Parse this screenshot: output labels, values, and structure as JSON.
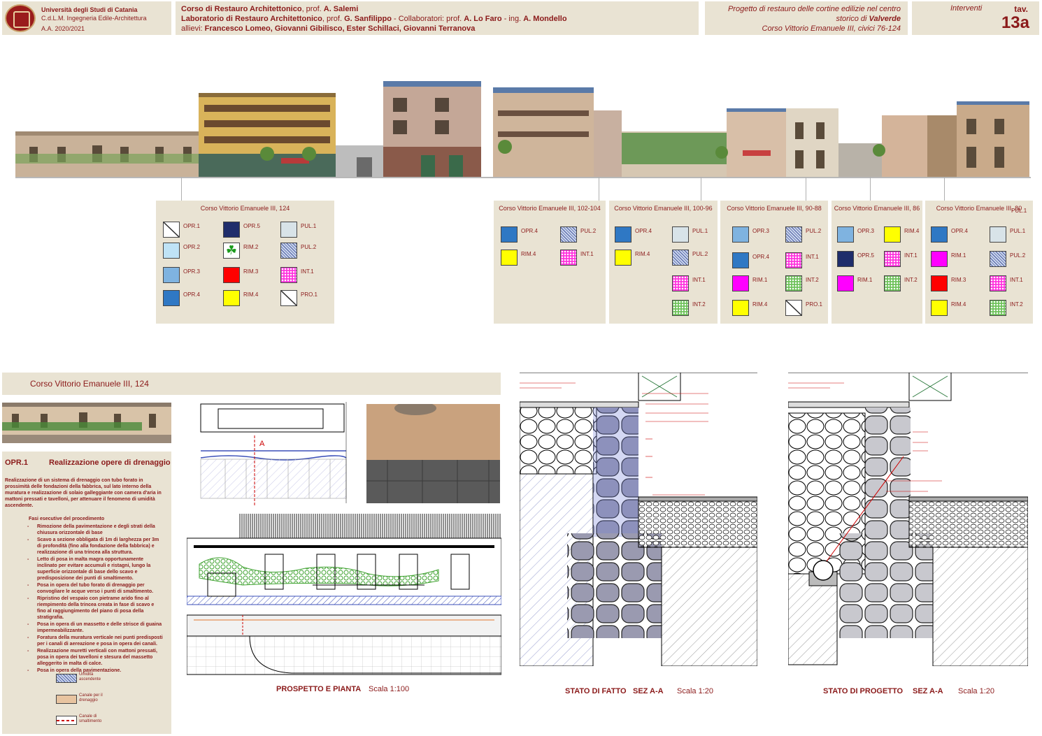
{
  "header": {
    "university": "Università degli Studi di Catania",
    "course": "C.d.L.M. Ingegneria Edile-Architettura",
    "year": "A.A. 2020/2021",
    "line1_a": "Corso di Restauro Architettonico",
    "line1_b": ", prof. ",
    "line1_c": "A. Salemi",
    "line2_a": "Laboratorio di Restauro Architettonico",
    "line2_b": ", prof. ",
    "line2_c": "G. Sanfilippo",
    "line2_d": " - Collaboratori: prof. ",
    "line2_e": "A. Lo Faro",
    "line2_f": " - ing. ",
    "line2_g": "A. Mondello",
    "line3_a": "allievi:  ",
    "line3_b": "Francesco Lomeo, Giovanni Gibilisco, Ester Schillaci, Giovanni Terranova",
    "project_1": "Progetto di restauro delle cortine edilizie nel centro",
    "project_2a": "storico di ",
    "project_2b": "Valverde",
    "project_3": "Corso Vittorio Emanuele III, civici 76-124",
    "section": "Interventi",
    "tav_label": "tav.",
    "tav_num": "13a"
  },
  "legends": [
    {
      "title": "Corso Vittorio Emanuele III, 124",
      "items": [
        {
          "code": "OPR.1",
          "swatch": "diag-white"
        },
        {
          "code": "OPR.2",
          "swatch": "#bfe3f6"
        },
        {
          "code": "OPR.3",
          "swatch": "#7fb3e0"
        },
        {
          "code": "OPR.4",
          "swatch": "#2f78c4"
        },
        {
          "code": "OPR.5",
          "swatch": "#1f2d6b"
        },
        {
          "code": "RIM.2",
          "swatch": "clover"
        },
        {
          "code": "RIM.3",
          "swatch": "#ff0000"
        },
        {
          "code": "RIM.4",
          "swatch": "#ffff00"
        },
        {
          "code": "PUL.1",
          "swatch": "#d8e3e8"
        },
        {
          "code": "PUL.2",
          "swatch": "hatch-blue"
        },
        {
          "code": "INT.1",
          "swatch": "dots-magenta"
        },
        {
          "code": "PRO.1",
          "swatch": "diag-white"
        }
      ]
    },
    {
      "title": "Corso Vittorio Emanuele III, 102-104",
      "items": [
        {
          "code": "OPR.4",
          "swatch": "#2f78c4"
        },
        {
          "code": "RIM.4",
          "swatch": "#ffff00"
        },
        {
          "code": "PUL.2",
          "swatch": "hatch-blue"
        },
        {
          "code": "INT.1",
          "swatch": "dots-magenta"
        }
      ]
    },
    {
      "title": "Corso Vittorio Emanuele III, 100-96",
      "items": [
        {
          "code": "OPR.4",
          "swatch": "#2f78c4"
        },
        {
          "code": "RIM.4",
          "swatch": "#ffff00"
        },
        {
          "code": "PUL.1",
          "swatch": "#d8e3e8"
        },
        {
          "code": "PUL.2",
          "swatch": "hatch-blue"
        },
        {
          "code": "INT.1",
          "swatch": "dots-magenta"
        },
        {
          "code": "INT.2",
          "swatch": "dots-green"
        }
      ]
    },
    {
      "title": "Corso Vittorio Emanuele III, 90-88",
      "items": [
        {
          "code": "OPR.3",
          "swatch": "#7fb3e0"
        },
        {
          "code": "OPR.4",
          "swatch": "#2f78c4"
        },
        {
          "code": "RIM.1",
          "swatch": "#ff00ff"
        },
        {
          "code": "RIM.4",
          "swatch": "#ffff00"
        },
        {
          "code": "PUL.2",
          "swatch": "hatch-blue"
        },
        {
          "code": "INT.1",
          "swatch": "dots-magenta"
        },
        {
          "code": "INT.2",
          "swatch": "dots-green"
        },
        {
          "code": "PRO.1",
          "swatch": "diag-white"
        }
      ]
    },
    {
      "title": "Corso Vittorio Emanuele III, 86",
      "items": [
        {
          "code": "OPR.3",
          "swatch": "#7fb3e0"
        },
        {
          "code": "OPR.5",
          "swatch": "#1f2d6b"
        },
        {
          "code": "RIM.1",
          "swatch": "#ff00ff"
        },
        {
          "code": "RIM.4",
          "swatch": "#ffff00"
        },
        {
          "code": "INT.1",
          "swatch": "dots-magenta"
        },
        {
          "code": "INT.2",
          "swatch": "dots-green"
        }
      ]
    },
    {
      "title": "Corso Vittorio Emanuele III, 80",
      "items": [
        {
          "code": "OPR.4",
          "swatch": "#2f78c4"
        },
        {
          "code": "RIM.1",
          "swatch": "#ff00ff"
        },
        {
          "code": "RIM.3",
          "swatch": "#ff0000"
        },
        {
          "code": "RIM.4",
          "swatch": "#ffff00"
        },
        {
          "code": "PUL.1",
          "swatch": "#d8e3e8"
        },
        {
          "code": "PUL.2",
          "swatch": "hatch-blue"
        },
        {
          "code": "INT.1",
          "swatch": "dots-magenta"
        },
        {
          "code": "INT.2",
          "swatch": "dots-green"
        }
      ]
    }
  ],
  "extra_label": "PUL.1",
  "detail": {
    "title": "Corso Vittorio Emanuele III, 124",
    "code": "OPR.1",
    "heading": "Realizzazione opere di drenaggio",
    "intro": "Realizzazione di un sistema di drenaggio con tubo forato in prossimità delle fondazioni della fabbrica, sul lato interno della muratura e realizzazione di solaio galleggiante con camera d'aria in mattoni pressati e tavelloni, per attenuare il fenomeno di umidità ascendente.",
    "steps_title": "Fasi esecutive del procedimento",
    "steps": [
      "Rimozione della pavimentazione e degli strati della chiusura orizzontale di base",
      "Scavo a sezione obbligata di 1m di larghezza per 3m di profondità (fino alla fondazione della fabbrica) e realizzazione di una trincea alla struttura.",
      "Letto di posa in malta magra opportunamente inclinato per evitare accumuli e ristagni, lungo la superficie orizzontale di base dello scavo e predisposizione dei punti di smaltimento.",
      "Posa in opera del tubo forato di drenaggio per convogliare le acque verso i punti di smaltimento.",
      "Ripristino del vespaio con pietrame arido fino al riempimento della trincea creata in fase di scavo e fino al raggiungimento del piano di posa della stratigrafia.",
      "Posa in opera di un massetto e delle strisce di guaina impermeabilizzante.",
      "Foratura della muratura verticale nei punti predisposti per i canali di aereazione e posa in opera dei canali.",
      "Realizzazione muretti verticali con mattoni pressati, posa in opera dei tavelloni e stesura del massetto alleggerito in malta di calce.",
      "Posa in opera della pavimentazione."
    ],
    "key": [
      {
        "label": "Umidità ascendente",
        "swatch": "hatch-blue"
      },
      {
        "label": "Canale per il drenaggio",
        "swatch": "#e8c4a0"
      },
      {
        "label": "Canale di smaltimento",
        "swatch": "dash-red"
      }
    ]
  },
  "captions": {
    "prospetto": "PROSPETTO E PIANTA",
    "prospetto_scale": "Scala 1:100",
    "fatto": "STATO DI FATTO",
    "fatto_sez": "SEZ A-A",
    "fatto_scale": "Scala 1:20",
    "progetto": "STATO DI PROGETTO",
    "progetto_sez": "SEZ A-A",
    "progetto_scale": "Scala 1:20",
    "section_mark": "A"
  },
  "colors": {
    "panel_bg": "#e9e3d3",
    "accent_red": "#8b1a1a",
    "umidita_blue": "#3b4fb8",
    "ivy_green": "#3fbf2a",
    "stone_gray": "#9a9aa8"
  }
}
